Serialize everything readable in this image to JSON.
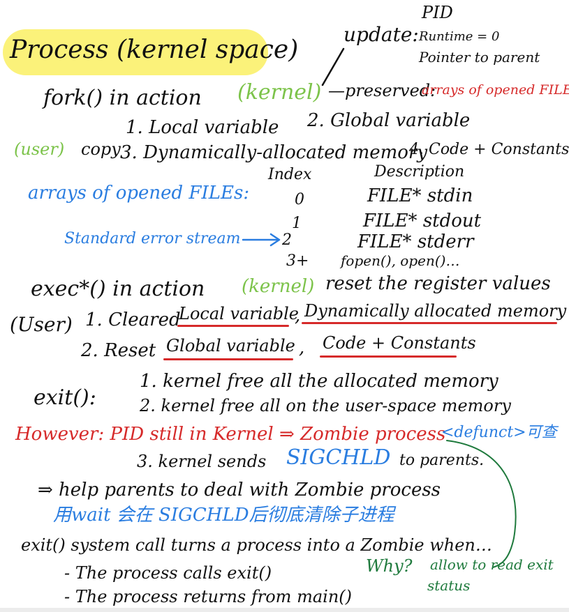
{
  "colors": {
    "ink": "#111111",
    "red": "#d62a2a",
    "green": "#7cc34a",
    "blue": "#2a7de0",
    "dark_green": "#1f7a3d",
    "highlight": "#fbf27a"
  },
  "header": {
    "title": "Process (kernel space)",
    "update_label": "update:",
    "update_items": [
      "PID",
      "Runtime = 0",
      "Pointer to parent"
    ]
  },
  "fork": {
    "line": "fork() in action",
    "kernel_tag": "(kernel)",
    "preserved": "—preserved:",
    "preserved_what": "arrays of opened FILE",
    "user_tag": "(user)",
    "copy_label": "copy",
    "items": [
      "1. Local variable",
      "2. Global variable",
      "3. Dynamically-allocated memory",
      "4. Code + Constants"
    ]
  },
  "files": {
    "title": "arrays of opened FILEs:",
    "index_header": "Index",
    "desc_header": "Description",
    "rows": [
      {
        "index": "0",
        "desc": "FILE* stdin"
      },
      {
        "index": "1",
        "desc": "FILE* stdout"
      },
      {
        "index": "2",
        "desc": "FILE* stderr"
      },
      {
        "index": "3+",
        "desc": "fopen(), open()…"
      }
    ],
    "stderr_note": "Standard error stream"
  },
  "exec": {
    "line": "exec*() in action",
    "kernel_tag": "(kernel)",
    "rest": "reset the register values",
    "user_tag": "(User)",
    "step1_prefix": "1. Cleared",
    "step1_a": "Local variable",
    "step1_sep": ",",
    "step1_b": "Dynamically allocated memory",
    "step2_prefix": "2. Reset",
    "step2_a": "Global variable",
    "step2_sep": ",",
    "step2_b": "Code + Constants"
  },
  "exit": {
    "label": "exit():",
    "step1": "1. kernel free all the allocated memory",
    "step2": "2. kernel free all on the user-space memory",
    "however": "However: PID still in Kernel ⇒ Zombie process",
    "defunct": "<defunct>可查",
    "step3_prefix": "3. kernel sends",
    "step3_signal": "SIGCHLD",
    "step3_suffix": "to parents.",
    "help": "⇒ help parents to deal with Zombie process",
    "wait_note": "用wait 会在 SIGCHLD后彻底清除子进程",
    "zombie_line": "exit() system call turns a process into a Zombie when…",
    "bullet1": "- The process calls exit()",
    "bullet2": "- The process returns from main()",
    "why": "Why?",
    "why_note_1": "allow to read exit",
    "why_note_2": "status"
  }
}
